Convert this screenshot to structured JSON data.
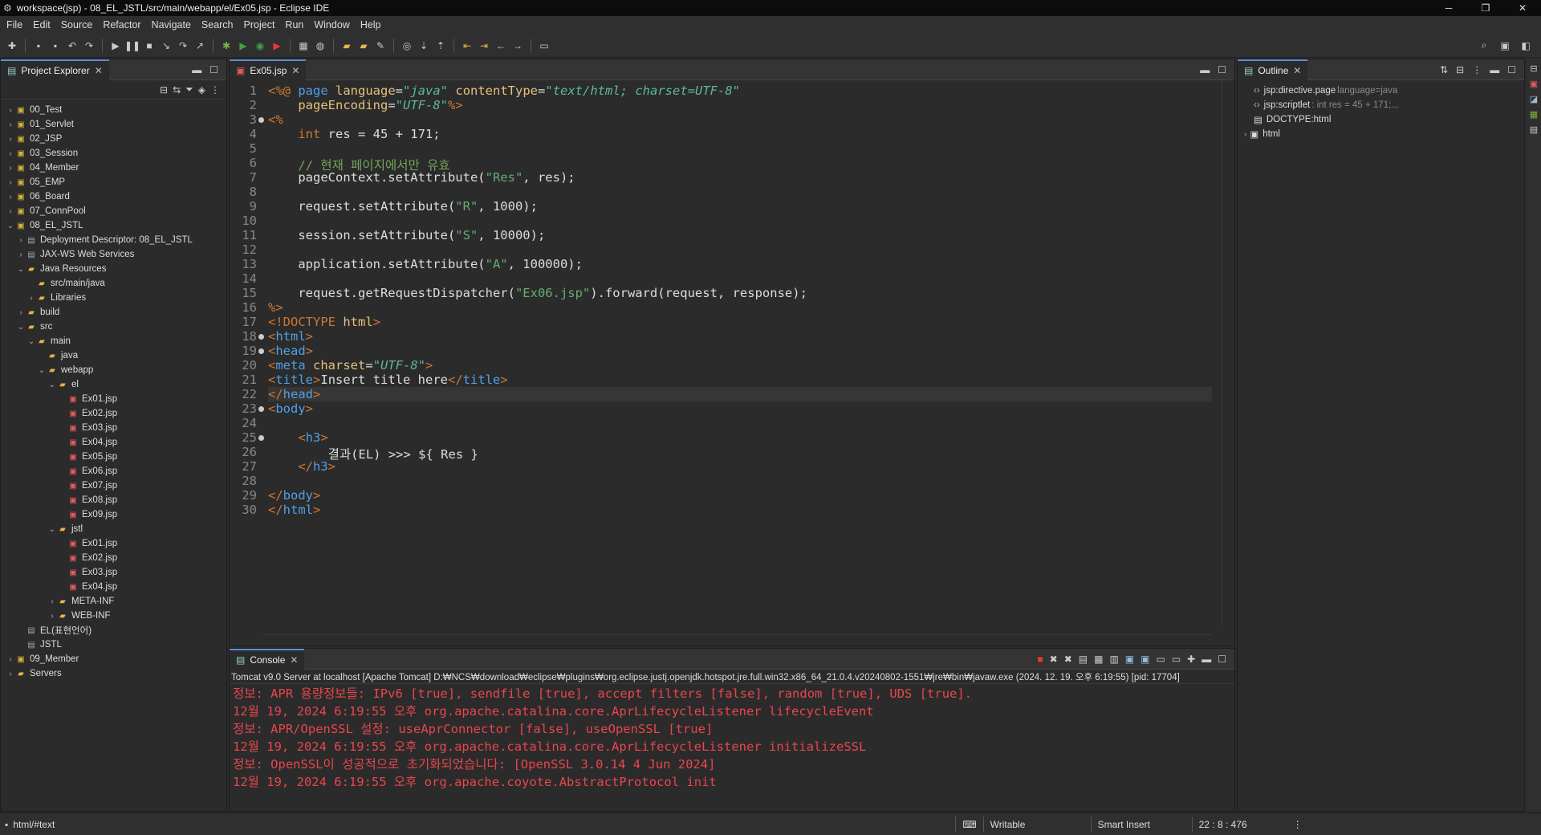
{
  "window": {
    "title": "workspace(jsp) - 08_EL_JSTL/src/main/webapp/el/Ex05.jsp - Eclipse IDE",
    "minimize": "─",
    "maximize": "❐",
    "close": "✕"
  },
  "menu": [
    "File",
    "Edit",
    "Source",
    "Refactor",
    "Navigate",
    "Search",
    "Project",
    "Run",
    "Window",
    "Help"
  ],
  "explorer": {
    "tab_label": "Project Explorer",
    "items": [
      {
        "label": "00_Test",
        "depth": 0,
        "arrow": "›",
        "icon": "project"
      },
      {
        "label": "01_Servlet",
        "depth": 0,
        "arrow": "›",
        "icon": "project"
      },
      {
        "label": "02_JSP",
        "depth": 0,
        "arrow": "›",
        "icon": "project"
      },
      {
        "label": "03_Session",
        "depth": 0,
        "arrow": "›",
        "icon": "project"
      },
      {
        "label": "04_Member",
        "depth": 0,
        "arrow": "›",
        "icon": "project"
      },
      {
        "label": "05_EMP",
        "depth": 0,
        "arrow": "›",
        "icon": "project"
      },
      {
        "label": "06_Board",
        "depth": 0,
        "arrow": "›",
        "icon": "project"
      },
      {
        "label": "07_ConnPool",
        "depth": 0,
        "arrow": "›",
        "icon": "project"
      },
      {
        "label": "08_EL_JSTL",
        "depth": 0,
        "arrow": "⌄",
        "icon": "project"
      },
      {
        "label": "Deployment Descriptor: 08_EL_JSTL",
        "depth": 1,
        "arrow": "›",
        "icon": "gen"
      },
      {
        "label": "JAX-WS Web Services",
        "depth": 1,
        "arrow": "›",
        "icon": "gen"
      },
      {
        "label": "Java Resources",
        "depth": 1,
        "arrow": "⌄",
        "icon": "folder"
      },
      {
        "label": "src/main/java",
        "depth": 2,
        "arrow": "",
        "icon": "folder"
      },
      {
        "label": "Libraries",
        "depth": 2,
        "arrow": "›",
        "icon": "folder"
      },
      {
        "label": "build",
        "depth": 1,
        "arrow": "›",
        "icon": "folder"
      },
      {
        "label": "src",
        "depth": 1,
        "arrow": "⌄",
        "icon": "folder"
      },
      {
        "label": "main",
        "depth": 2,
        "arrow": "⌄",
        "icon": "folder"
      },
      {
        "label": "java",
        "depth": 3,
        "arrow": "",
        "icon": "folder"
      },
      {
        "label": "webapp",
        "depth": 3,
        "arrow": "⌄",
        "icon": "folder"
      },
      {
        "label": "el",
        "depth": 4,
        "arrow": "⌄",
        "icon": "folder"
      },
      {
        "label": "Ex01.jsp",
        "depth": 5,
        "arrow": "",
        "icon": "jsp"
      },
      {
        "label": "Ex02.jsp",
        "depth": 5,
        "arrow": "",
        "icon": "jsp"
      },
      {
        "label": "Ex03.jsp",
        "depth": 5,
        "arrow": "",
        "icon": "jsp"
      },
      {
        "label": "Ex04.jsp",
        "depth": 5,
        "arrow": "",
        "icon": "jsp"
      },
      {
        "label": "Ex05.jsp",
        "depth": 5,
        "arrow": "",
        "icon": "jsp"
      },
      {
        "label": "Ex06.jsp",
        "depth": 5,
        "arrow": "",
        "icon": "jsp"
      },
      {
        "label": "Ex07.jsp",
        "depth": 5,
        "arrow": "",
        "icon": "jsp"
      },
      {
        "label": "Ex08.jsp",
        "depth": 5,
        "arrow": "",
        "icon": "jsp"
      },
      {
        "label": "Ex09.jsp",
        "depth": 5,
        "arrow": "",
        "icon": "jsp"
      },
      {
        "label": "jstl",
        "depth": 4,
        "arrow": "⌄",
        "icon": "folder"
      },
      {
        "label": "Ex01.jsp",
        "depth": 5,
        "arrow": "",
        "icon": "jsp"
      },
      {
        "label": "Ex02.jsp",
        "depth": 5,
        "arrow": "",
        "icon": "jsp"
      },
      {
        "label": "Ex03.jsp",
        "depth": 5,
        "arrow": "",
        "icon": "jsp"
      },
      {
        "label": "Ex04.jsp",
        "depth": 5,
        "arrow": "",
        "icon": "jsp"
      },
      {
        "label": "META-INF",
        "depth": 4,
        "arrow": "›",
        "icon": "folder"
      },
      {
        "label": "WEB-INF",
        "depth": 4,
        "arrow": "›",
        "icon": "folder"
      },
      {
        "label": "EL(표현언어)",
        "depth": 1,
        "arrow": "",
        "icon": "gen"
      },
      {
        "label": "JSTL",
        "depth": 1,
        "arrow": "",
        "icon": "gen"
      },
      {
        "label": "09_Member",
        "depth": 0,
        "arrow": "›",
        "icon": "project"
      },
      {
        "label": "Servers",
        "depth": 0,
        "arrow": "›",
        "icon": "folder"
      }
    ]
  },
  "editor": {
    "tab_label": "Ex05.jsp",
    "lines": [
      {
        "n": "1",
        "fold": false,
        "html": "<span class='dir'>&lt;%@</span> <span class='tag'>page</span> <span class='attr'>language</span>=<span class='str'>\"java\"</span> <span class='attr'>contentType</span>=<span class='str'>\"text/html; charset=UTF-8\"</span>"
      },
      {
        "n": "2",
        "fold": false,
        "html": "    <span class='attr'>pageEncoding</span>=<span class='str'>\"UTF-8\"</span><span class='dir'>%&gt;</span>"
      },
      {
        "n": "3",
        "fold": true,
        "html": "<span class='dir'>&lt;%</span>"
      },
      {
        "n": "4",
        "fold": false,
        "html": "    <span class='kw'>int</span> res = 45 + 171;"
      },
      {
        "n": "5",
        "fold": false,
        "html": ""
      },
      {
        "n": "6",
        "fold": false,
        "html": "    <span class='cm'>// 현재 페이지에서만 유효</span>"
      },
      {
        "n": "7",
        "fold": false,
        "html": "    pageContext.setAttribute(<span class='sq'>\"Res\"</span>, res);"
      },
      {
        "n": "8",
        "fold": false,
        "html": ""
      },
      {
        "n": "9",
        "fold": false,
        "html": "    request.setAttribute(<span class='sq'>\"R\"</span>, 1000);"
      },
      {
        "n": "10",
        "fold": false,
        "html": ""
      },
      {
        "n": "11",
        "fold": false,
        "html": "    session.setAttribute(<span class='sq'>\"S\"</span>, 10000);"
      },
      {
        "n": "12",
        "fold": false,
        "html": ""
      },
      {
        "n": "13",
        "fold": false,
        "html": "    application.setAttribute(<span class='sq'>\"A\"</span>, 100000);"
      },
      {
        "n": "14",
        "fold": false,
        "html": ""
      },
      {
        "n": "15",
        "fold": false,
        "html": "    request.getRequestDispatcher(<span class='sq'>\"Ex06.jsp\"</span>).forward(request, response);"
      },
      {
        "n": "16",
        "fold": false,
        "html": "<span class='dir'>%&gt;</span>"
      },
      {
        "n": "17",
        "fold": false,
        "html": "<span class='dir'>&lt;!DOCTYPE</span> <span class='attr'>html</span><span class='dir'>&gt;</span>"
      },
      {
        "n": "18",
        "fold": true,
        "html": "<span class='kw'>&lt;</span><span class='tag'>html</span><span class='kw'>&gt;</span>"
      },
      {
        "n": "19",
        "fold": true,
        "html": "<span class='kw'>&lt;</span><span class='tag'>head</span><span class='kw'>&gt;</span>"
      },
      {
        "n": "20",
        "fold": false,
        "html": "<span class='kw'>&lt;</span><span class='tag'>meta</span> <span class='attr'>charset</span>=<span class='str'>\"UTF-8\"</span><span class='kw'>&gt;</span>"
      },
      {
        "n": "21",
        "fold": false,
        "html": "<span class='kw'>&lt;</span><span class='tag'>title</span><span class='kw'>&gt;</span>Insert title here<span class='kw'>&lt;/</span><span class='tag'>title</span><span class='kw'>&gt;</span>"
      },
      {
        "n": "22",
        "fold": false,
        "html": "<span class='kw'>&lt;/</span><span class='tag'>head</span><span class='kw'>&gt;</span>"
      },
      {
        "n": "23",
        "fold": true,
        "html": "<span class='kw'>&lt;</span><span class='tag'>body</span><span class='kw'>&gt;</span>"
      },
      {
        "n": "24",
        "fold": false,
        "html": ""
      },
      {
        "n": "25",
        "fold": true,
        "html": "    <span class='kw'>&lt;</span><span class='tag'>h3</span><span class='kw'>&gt;</span>"
      },
      {
        "n": "26",
        "fold": false,
        "html": "        결과(EL) &gt;&gt;&gt; ${ Res }"
      },
      {
        "n": "27",
        "fold": false,
        "html": "    <span class='kw'>&lt;/</span><span class='tag'>h3</span><span class='kw'>&gt;</span>"
      },
      {
        "n": "28",
        "fold": false,
        "html": ""
      },
      {
        "n": "29",
        "fold": false,
        "html": "<span class='kw'>&lt;/</span><span class='tag'>body</span><span class='kw'>&gt;</span>"
      },
      {
        "n": "30",
        "fold": false,
        "html": "<span class='kw'>&lt;/</span><span class='tag'>html</span><span class='kw'>&gt;</span>"
      }
    ],
    "current_line": 22
  },
  "outline": {
    "tab_label": "Outline",
    "items": [
      {
        "label": "jsp:directive.page",
        "sub": "language=java",
        "icon": "‹›"
      },
      {
        "label": "jsp:scriptlet",
        "sub": ": int res = 45 + 171;...",
        "icon": "‹›"
      },
      {
        "label": "DOCTYPE:html",
        "sub": "",
        "icon": "▤"
      },
      {
        "label": "html",
        "sub": "",
        "icon": "▣"
      }
    ]
  },
  "console": {
    "tab_label": "Console",
    "status": "Tomcat v9.0 Server at localhost [Apache Tomcat] D:₩NCS₩download₩eclipse₩plugins₩org.eclipse.justj.openjdk.hotspot.jre.full.win32.x86_64_21.0.4.v20240802-1551₩jre₩bin₩javaw.exe  (2024. 12. 19. 오후 6:19:55) [pid: 17704]",
    "lines": [
      "정보: APR 용량정보들: IPv6 [true], sendfile [true], accept filters [false], random [true], UDS [true].",
      "12월 19, 2024 6:19:55 오후 org.apache.catalina.core.AprLifecycleListener lifecycleEvent",
      "정보: APR/OpenSSL 설정: useAprConnector [false], useOpenSSL [true]",
      "12월 19, 2024 6:19:55 오후 org.apache.catalina.core.AprLifecycleListener initializeSSL",
      "정보: OpenSSL이 성공적으로 초기화되었습니다: [OpenSSL 3.0.14 4 Jun 2024]",
      "12월 19, 2024 6:19:55 오후 org.apache.coyote.AbstractProtocol init"
    ]
  },
  "statusbar": {
    "left": "html/#text",
    "writable": "Writable",
    "insert": "Smart Insert",
    "position": "22 : 8 : 476"
  }
}
